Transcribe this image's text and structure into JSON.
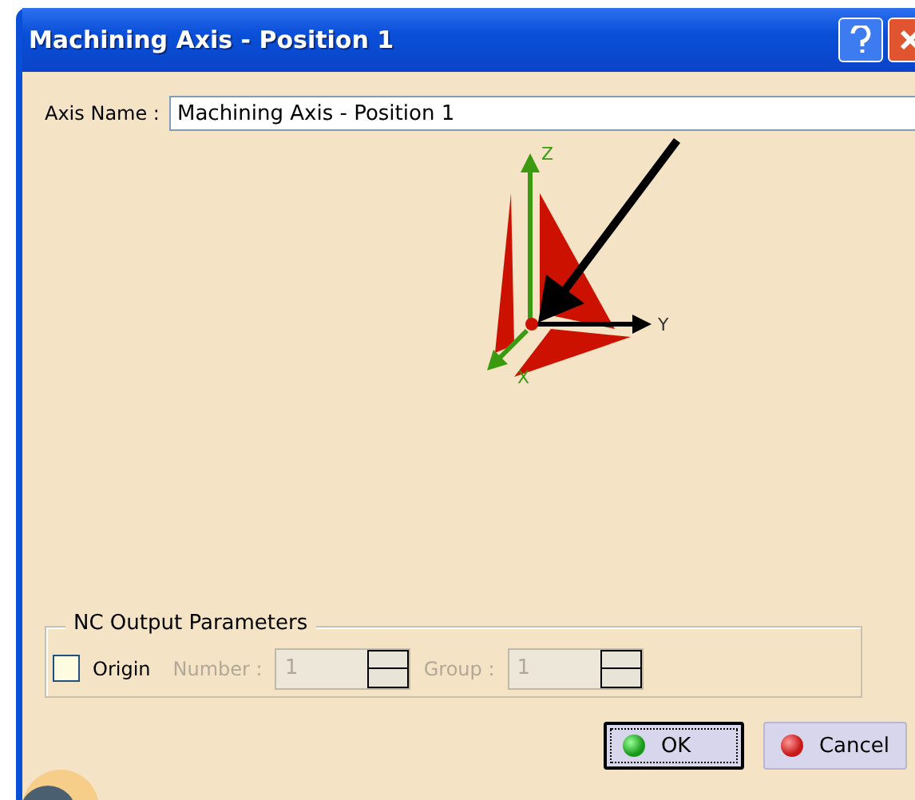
{
  "window": {
    "title": "Machining Axis - Position 1"
  },
  "axis_name": {
    "label": "Axis Name :",
    "value": "Machining Axis - Position 1"
  },
  "axis_labels": {
    "z": "Z",
    "y": "Y",
    "x": "X"
  },
  "nc_output": {
    "legend": "NC Output Parameters",
    "origin": {
      "label": "Origin",
      "checked": false
    },
    "fields": [
      {
        "label": "Number :",
        "value": "1",
        "disabled": true
      },
      {
        "label": "Group :",
        "value": "1",
        "disabled": true
      }
    ]
  },
  "buttons": [
    {
      "label": "OK",
      "kind": "ok",
      "focused": true
    },
    {
      "label": "Cancel",
      "kind": "cancel",
      "focused": false
    }
  ]
}
